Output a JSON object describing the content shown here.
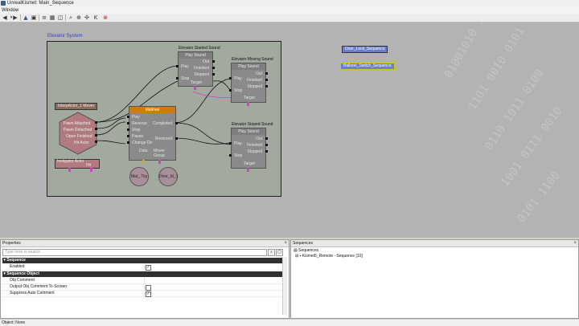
{
  "window": {
    "title": "UnrealKismet: Main_Sequence"
  },
  "menu": {
    "items": [
      "Window"
    ]
  },
  "canvas": {
    "comment_title": "Elevator System",
    "side_objects": [
      "Door_Lock_Sequence",
      "Balloon_Switch_Sequence"
    ],
    "nodes": {
      "started_sound": {
        "title": "Elevator Started Sound",
        "header": "Play Sound",
        "inputs": [
          "Play",
          "Stop"
        ],
        "outputs": [
          "Out",
          "Finished",
          "Stopped"
        ],
        "footer": "Target"
      },
      "moving_sound": {
        "title": "Elevator Moving Sound",
        "header": "Play Sound",
        "inputs": [
          "Play",
          "Stop"
        ],
        "outputs": [
          "Out",
          "Finished",
          "Stopped"
        ],
        "footer": "Target"
      },
      "stopped_sound": {
        "title": "Elevator Stoped Sound",
        "header": "Play Sound",
        "inputs": [
          "Play",
          "Stop"
        ],
        "outputs": [
          "Out",
          "Finished",
          "Stopped"
        ],
        "footer": "Target"
      },
      "interp_actor": {
        "label": "InterpActor_1 Mover",
        "outputs": [
          "Pawn Attached",
          "Pawn Detached",
          "Open Finished",
          "Hit Actor"
        ],
        "bottom": "Instigator",
        "bottom_right": "Actor",
        "bottom_right2": "Hit"
      },
      "matinee": {
        "header": "Matinee",
        "inputs": [
          "Play",
          "Reverse",
          "Stop",
          "Pause",
          "Change Dir"
        ],
        "outputs": [
          "Completed",
          "Reversed"
        ],
        "bottom": [
          "Data",
          "Mover",
          "Group"
        ]
      },
      "var_mat": "Mat_ Toy",
      "var_door": "Door_Id_1"
    }
  },
  "properties": {
    "title": "Properties",
    "search_placeholder": "Type here to search",
    "categories": [
      {
        "name": "Sequence",
        "rows": [
          {
            "name": "Enabled",
            "checked": true
          }
        ]
      },
      {
        "name": "Sequence Object",
        "rows": [
          {
            "name": "Obj Comment",
            "checked": null
          },
          {
            "name": "Output Obj Comment To Screen",
            "checked": false
          },
          {
            "name": "Suppress Auto Comment",
            "checked": true
          }
        ]
      }
    ]
  },
  "sequences": {
    "title": "Sequences",
    "root": "Sequences",
    "child": "Kismet5_Remote - Sequence [10]"
  },
  "status": {
    "text": "Object: None"
  },
  "colors": {
    "canvas": "#b3b3b3",
    "comment_box": "#a2aa9f",
    "matinee_header": "#d07a10",
    "seq_object": "#6b7fcf"
  }
}
